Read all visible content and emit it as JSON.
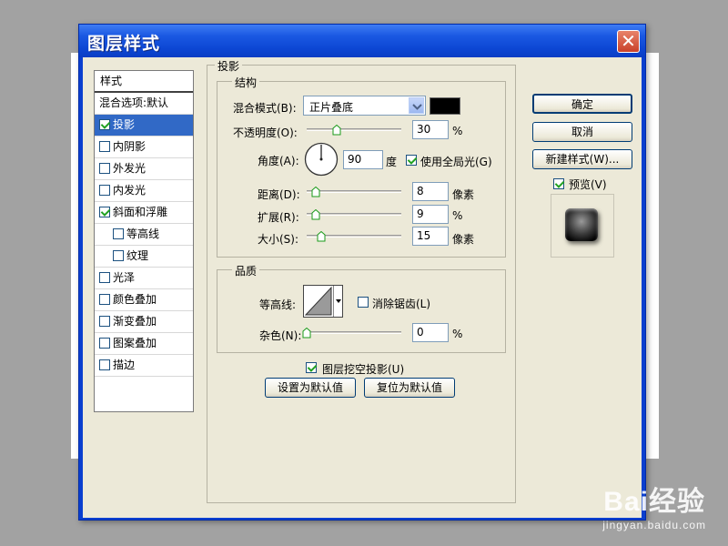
{
  "dialog": {
    "title": "图层样式",
    "close_glyph": "✕"
  },
  "styles": {
    "header": "样式",
    "blend": "混合选项:默认",
    "items": [
      {
        "label": "投影",
        "checked": true,
        "selected": true
      },
      {
        "label": "内阴影",
        "checked": false
      },
      {
        "label": "外发光",
        "checked": false
      },
      {
        "label": "内发光",
        "checked": false
      },
      {
        "label": "斜面和浮雕",
        "checked": true
      },
      {
        "label": "等高线",
        "checked": false,
        "sub": true
      },
      {
        "label": "纹理",
        "checked": false,
        "sub": true
      },
      {
        "label": "光泽",
        "checked": false
      },
      {
        "label": "颜色叠加",
        "checked": false
      },
      {
        "label": "渐变叠加",
        "checked": false
      },
      {
        "label": "图案叠加",
        "checked": false
      },
      {
        "label": "描边",
        "checked": false
      }
    ]
  },
  "drop_shadow": {
    "section_title": "投影",
    "structure_title": "结构",
    "blend_mode_label": "混合模式(B):",
    "blend_mode_value": "正片叠底",
    "shadow_color": "#000000",
    "opacity_label": "不透明度(O):",
    "opacity_value": "30",
    "opacity_unit": "%",
    "angle_label": "角度(A):",
    "angle_value": "90",
    "angle_unit": "度",
    "global_light_label": "使用全局光(G)",
    "global_light_checked": true,
    "distance_label": "距离(D):",
    "distance_value": "8",
    "distance_unit": "像素",
    "spread_label": "扩展(R):",
    "spread_value": "9",
    "spread_unit": "%",
    "size_label": "大小(S):",
    "size_value": "15",
    "size_unit": "像素"
  },
  "quality": {
    "title": "品质",
    "contour_label": "等高线:",
    "antialias_label": "消除锯齿(L)",
    "antialias_checked": false,
    "noise_label": "杂色(N):",
    "noise_value": "0",
    "noise_unit": "%"
  },
  "knockout": {
    "label": "图层挖空投影(U)",
    "checked": true
  },
  "bottom_buttons": {
    "set_default": "设置为默认值",
    "reset_default": "复位为默认值"
  },
  "side_buttons": {
    "ok": "确定",
    "cancel": "取消",
    "new_style": "新建样式(W)...",
    "preview_label": "预览(V)",
    "preview_checked": true
  },
  "watermark": {
    "brand": "Bai经验",
    "url": "jingyan.baidu.com"
  },
  "colors": {
    "title_bar": "#0a3fcf",
    "selection": "#3169c6",
    "dialog_bg": "#ece9d8"
  }
}
